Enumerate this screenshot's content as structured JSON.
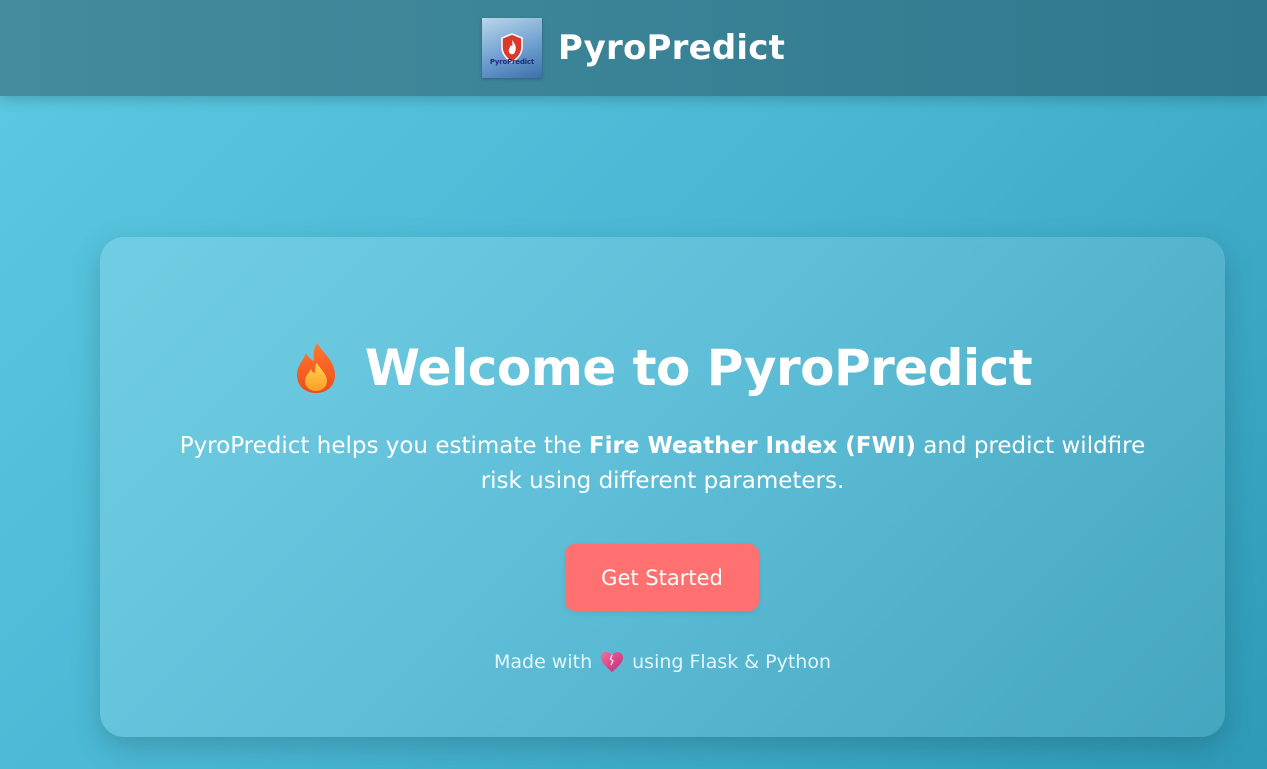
{
  "navbar": {
    "logo_text": "PyroPredict",
    "brand": "PyroPredict"
  },
  "hero": {
    "icon": "fire-icon",
    "title": "Welcome to PyroPredict",
    "desc_prefix": "PyroPredict helps you estimate the ",
    "desc_bold": "Fire Weather Index (FWI)",
    "desc_suffix": " and predict wildfire risk using different parameters.",
    "cta_label": "Get Started"
  },
  "footer": {
    "prefix": "Made with",
    "icon": "heart-icon",
    "suffix": "using Flask & Python"
  },
  "colors": {
    "cta": "#ff7171",
    "background": "#48b6d3",
    "navbar": "#3a8296"
  }
}
